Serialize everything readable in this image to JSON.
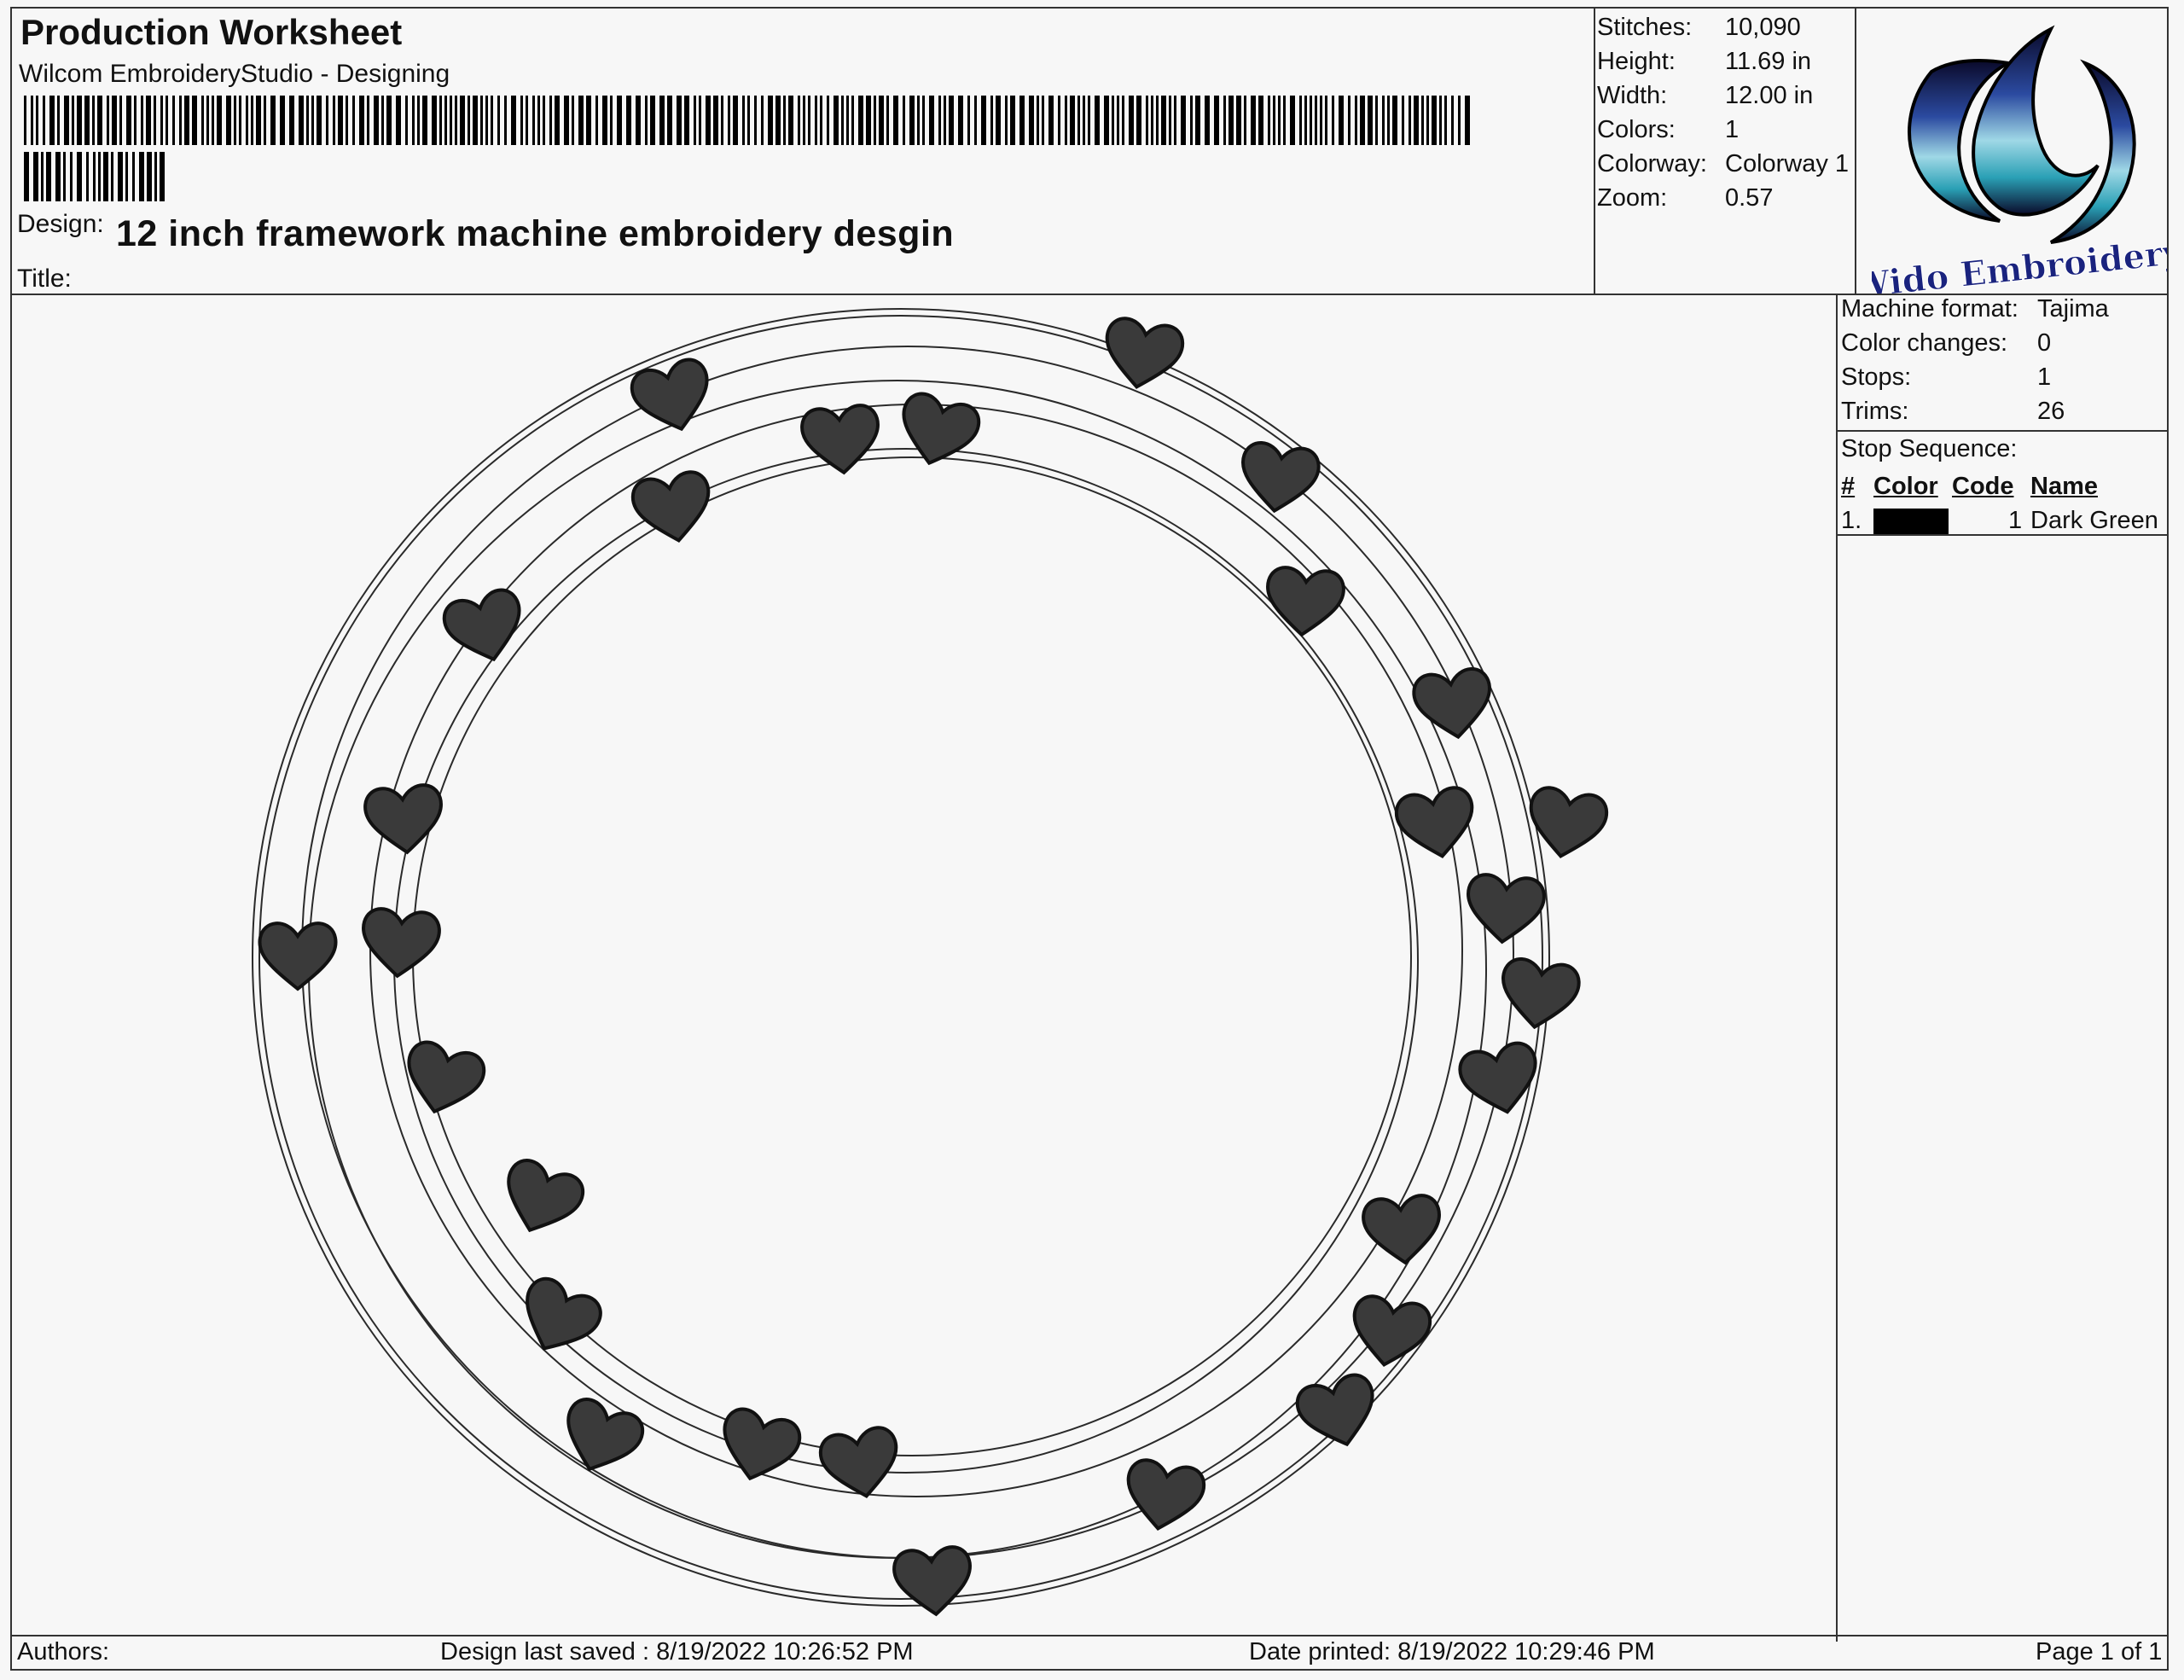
{
  "header": {
    "title": "Production Worksheet",
    "subtitle": "Wilcom EmbroideryStudio - Designing",
    "design_label": "Design:",
    "design_name": "12 inch framework machine embroidery desgin",
    "title_label": "Title:"
  },
  "stats": [
    {
      "label": "Stitches:",
      "value": "10,090"
    },
    {
      "label": "Height:",
      "value": "11.69 in"
    },
    {
      "label": "Width:",
      "value": "12.00 in"
    },
    {
      "label": "Colors:",
      "value": "1"
    },
    {
      "label": "Colorway:",
      "value": "Colorway 1"
    },
    {
      "label": "Zoom:",
      "value": "0.57"
    }
  ],
  "logo": {
    "text": "Wido Embroidery",
    "colors": {
      "dark": "#0a0a2a",
      "blue": "#2b4aa0",
      "teal": "#2aa0b5",
      "text": "#1a237e"
    }
  },
  "machine": [
    {
      "label": "Machine format:",
      "value": "Tajima"
    },
    {
      "label": "Color changes:",
      "value": "0"
    },
    {
      "label": "Stops:",
      "value": "1"
    },
    {
      "label": "Trims:",
      "value": "26"
    }
  ],
  "stop_sequence": {
    "label": "Stop Sequence:",
    "columns": [
      "#",
      "Color",
      "Code",
      "Name"
    ],
    "rows": [
      {
        "num": "1.",
        "color": "#000000",
        "code": "1",
        "name": "Dark Green"
      }
    ]
  },
  "design_art": {
    "stitch_color": "#2a2a2a",
    "heart_fill": "#3a3a3a"
  },
  "footer": {
    "authors": "Authors:",
    "saved": "Design last saved : 8/19/2022 10:26:52 PM",
    "printed": "Date printed: 8/19/2022 10:29:46 PM",
    "page": "Page 1 of 1"
  }
}
